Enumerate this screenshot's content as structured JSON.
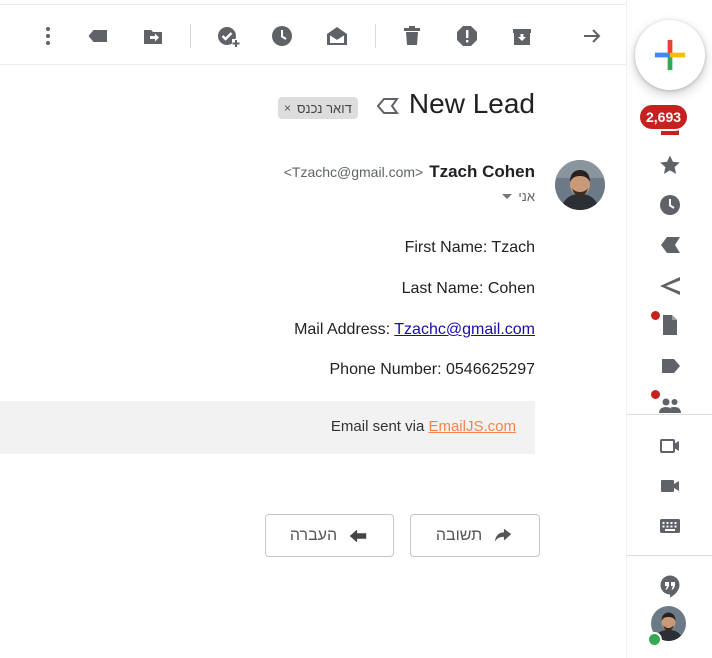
{
  "toolbar": {
    "icons": [
      "more-vert-icon",
      "label-icon",
      "move-to-icon",
      "add-to-tasks-icon",
      "snooze-icon",
      "mark-unread-icon",
      "delete-icon",
      "report-spam-icon",
      "archive-icon",
      "arrow-forward-icon"
    ]
  },
  "message": {
    "subject": "New Lead",
    "label": "דואר נכנס",
    "label_close": "×",
    "sender_name": "Tzach Cohen",
    "sender_email": "<Tzachc@gmail.com>",
    "to": "אני",
    "body": {
      "first_name": "First Name: Tzach",
      "last_name": "Last Name: Cohen",
      "mail_label": "Mail Address: ",
      "mail_value": "Tzachc@gmail.com",
      "phone": "Phone Number: 0546625297"
    },
    "footer_prefix": "Email sent via ",
    "footer_link": "EmailJS.com"
  },
  "actions": {
    "forward_label": "העברה",
    "reply_label": "תשובה"
  },
  "sidebar": {
    "unread_count": "2,693"
  },
  "colors": {
    "badge": "#c5221f",
    "link": "#1a0dab",
    "emailjs_link": "#f5844c",
    "online": "#34a853"
  }
}
